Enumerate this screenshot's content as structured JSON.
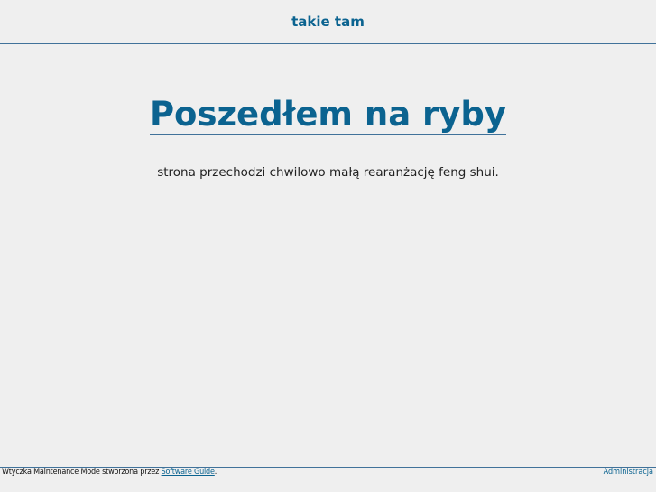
{
  "header": {
    "site_title": "takie tam"
  },
  "main": {
    "headline": "Poszedłem na ryby",
    "message": "strona przechodzi chwilowo małą rearanżację feng shui."
  },
  "footer": {
    "credit_prefix": "Wtyczka Maintenance Mode stworzona przez ",
    "credit_link": "Software Guide",
    "credit_suffix": ".",
    "admin_link": "Administracja"
  },
  "colors": {
    "accent": "#0b6390",
    "line": "#40729a",
    "background": "#efefef"
  }
}
